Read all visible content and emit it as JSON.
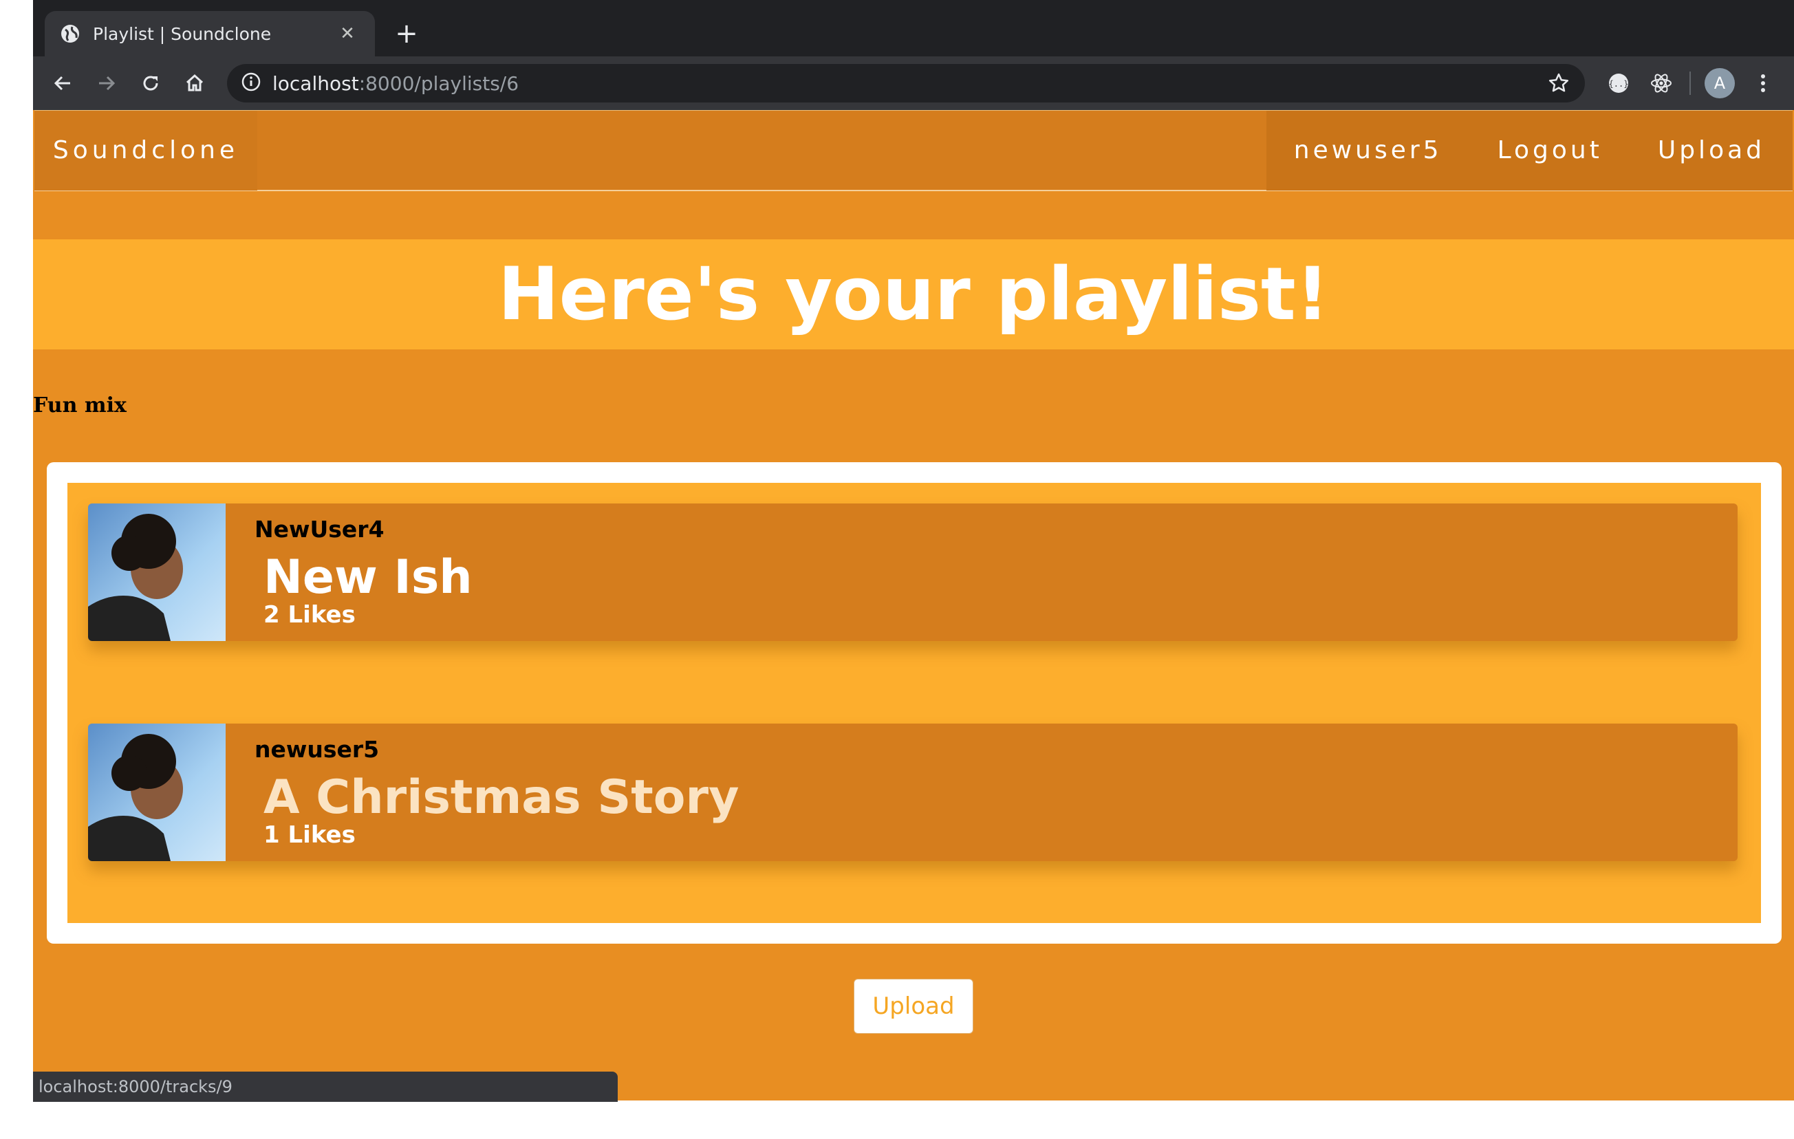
{
  "browser": {
    "tab": {
      "title": "Playlist | Soundclone",
      "favicon": "globe-icon",
      "close_icon": "✕"
    },
    "new_tab_icon": "+",
    "url_host": "localhost",
    "url_path": ":8000/playlists/6",
    "profile_initial": "A",
    "status_url": "localhost:8000/tracks/9"
  },
  "navbar": {
    "brand": "Soundclone",
    "user": "newuser5",
    "logout": "Logout",
    "upload": "Upload"
  },
  "hero": {
    "title": "Here's your playlist!"
  },
  "playlist": {
    "name": "Fun mix",
    "tracks": [
      {
        "uploader": "NewUser4",
        "title": "New Ish",
        "likes": "2 Likes",
        "title_color": "#ffffff"
      },
      {
        "uploader": "newuser5",
        "title": "A Christmas Story",
        "likes": "1 Likes",
        "title_color": "#fbe3c2"
      }
    ]
  },
  "footer": {
    "upload_button": "Upload"
  },
  "colors": {
    "page_bg": "#e88e22",
    "navbar": "#d57d1d",
    "hero": "#fdae2d",
    "card": "#d57d1d",
    "button_text": "#f5a623"
  }
}
